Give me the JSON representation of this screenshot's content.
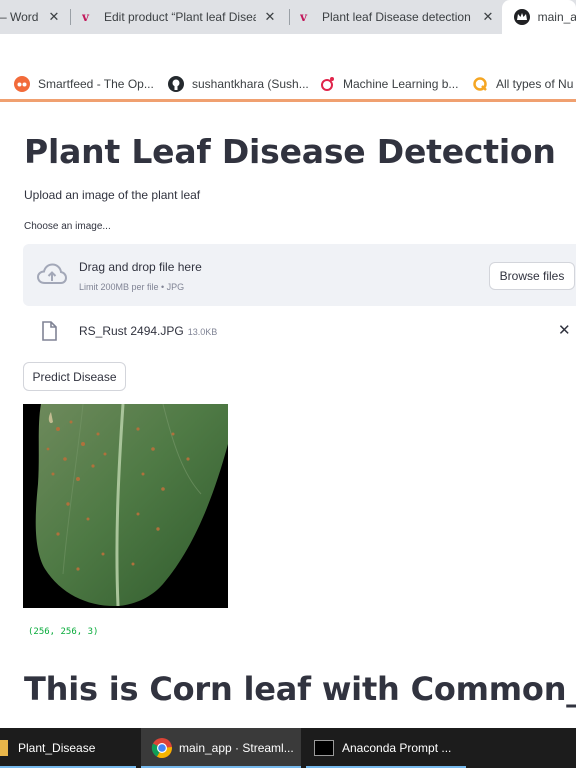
{
  "browser": {
    "tabs": [
      {
        "title": "– Word",
        "close": "✕"
      },
      {
        "title": "Edit product “Plant leaf Disea",
        "close": "✕"
      },
      {
        "title": "Plant leaf Disease detection F",
        "close": "✕"
      },
      {
        "title": "main_a",
        "close": ""
      }
    ],
    "bookmarks": [
      {
        "label": "Smartfeed - The Op...",
        "icon": "smartfeed-icon"
      },
      {
        "label": "sushantkhara (Sush...",
        "icon": "github-icon"
      },
      {
        "label": "Machine Learning b...",
        "icon": "ml-blog-icon"
      },
      {
        "label": "All types of Nu",
        "icon": "q-icon"
      }
    ],
    "accent_color": "#f0a070"
  },
  "page": {
    "title": "Plant Leaf Disease Detection",
    "subtitle": "Upload an image of the plant leaf",
    "uploader_label": "Choose an image...",
    "dropzone": {
      "title": "Drag and drop file here",
      "limit": "Limit 200MB per file • JPG",
      "browse_label": "Browse files"
    },
    "uploaded_file": {
      "name": "RS_Rust 2494.JPG",
      "size": "13.0KB",
      "remove": "✕"
    },
    "predict_label": "Predict Disease",
    "image_shape": "(256, 256, 3)",
    "result": "This is Corn leaf with Common_rust",
    "text_color": "#31333f",
    "shape_color": "#09ab3b"
  },
  "taskbar": {
    "items": [
      {
        "label": "Plant_Disease",
        "icon": "folder-icon"
      },
      {
        "label": "main_app · Streaml...",
        "icon": "chrome-icon"
      },
      {
        "label": "Anaconda Prompt ...",
        "icon": "terminal-icon"
      }
    ]
  }
}
